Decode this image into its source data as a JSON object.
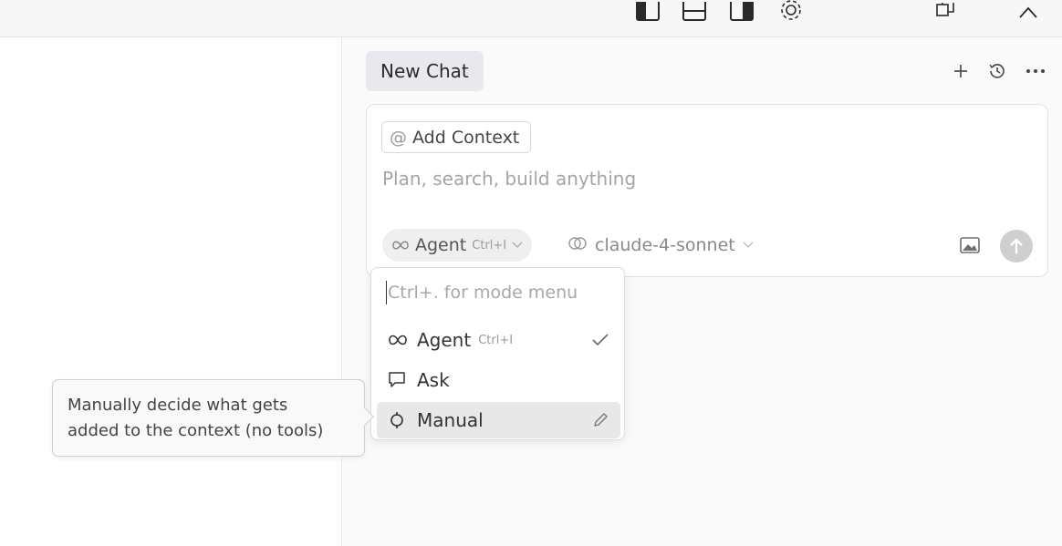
{
  "chat": {
    "tab_label": "New Chat",
    "add_context_label": "Add Context",
    "add_context_at": "@",
    "composer_placeholder": "Plan, search, build anything",
    "mode_label": "Agent",
    "mode_shortcut": "Ctrl+I",
    "model_label": "claude-4-sonnet"
  },
  "mode_menu": {
    "search_placeholder": "Ctrl+. for mode menu",
    "items": [
      {
        "label": "Agent",
        "shortcut": "Ctrl+I",
        "icon": "infinity-icon",
        "checked": true
      },
      {
        "label": "Ask",
        "icon": "chat-bubble-icon"
      },
      {
        "label": "Manual",
        "icon": "crosshair-icon",
        "highlighted": true
      }
    ]
  },
  "tooltip": {
    "line1": "Manually decide what gets",
    "line2": "added to the context (no tools)"
  },
  "icons": {
    "header": [
      "plus-icon",
      "history-icon",
      "more-icon"
    ],
    "topbar": [
      "panel-left-icon",
      "panel-bottom-icon",
      "panel-right-icon",
      "settings-icon",
      "restore-icon",
      "collapse-icon"
    ]
  },
  "colors": {
    "tab_bg": "#e8e9ef",
    "highlight_bg": "#e8e8e8",
    "send_btn": "#cfcfcf"
  }
}
